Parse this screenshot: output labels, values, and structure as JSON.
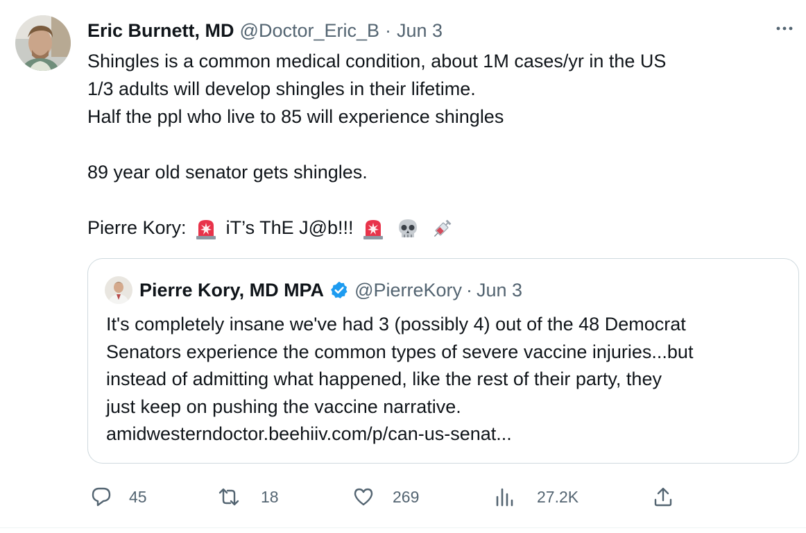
{
  "tweet": {
    "author": {
      "display_name": "Eric Burnett, MD",
      "handle": "@Doctor_Eric_B",
      "separator": "·",
      "date": "Jun 3"
    },
    "lines": [
      "Shingles is a common medical condition, about 1M cases/yr in the US",
      "1/3 adults will develop shingles in their lifetime.",
      "Half the ppl who live to 85 will experience shingles",
      "",
      "89 year old senator gets shingles.",
      "",
      "Pierre Kory:"
    ],
    "last_line": {
      "prefix": "Pierre Kory:",
      "middle": "iT’s ThE J@b!!!"
    },
    "emoji_icons": [
      "rotating-light-icon",
      "rotating-light-icon",
      "skull-icon",
      "syringe-icon"
    ],
    "more_icon": "more-horizontal-icon"
  },
  "quoted_tweet": {
    "author": {
      "display_name": "Pierre Kory, MD MPA",
      "verified_icon": "verified-badge-icon",
      "handle": "@PierreKory",
      "separator": "·",
      "date": "Jun 3"
    },
    "lines": [
      "It's completely insane we've had 3 (possibly 4) out of the 48 Democrat",
      "Senators experience the common types of severe vaccine injuries...but",
      "instead of admitting what happened, like the rest of their party, they",
      "just keep on pushing the vaccine narrative.",
      "amidwesterndoctor.beehiiv.com/p/can-us-senat..."
    ]
  },
  "actions": {
    "replies": "45",
    "retweets": "18",
    "likes": "269",
    "views": "27.2K",
    "icons": [
      "reply-icon",
      "retweet-icon",
      "like-icon",
      "views-icon",
      "share-icon"
    ]
  },
  "colors": {
    "text_primary": "#0f1419",
    "text_secondary": "#536471",
    "border": "#cfd9de",
    "verified": "#1d9bf0",
    "siren_red": "#e8334a"
  }
}
